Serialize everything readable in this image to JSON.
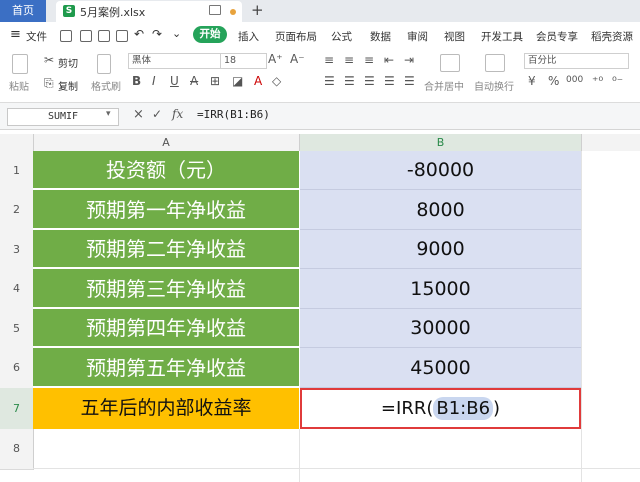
{
  "tabs": {
    "home": "首页",
    "file_name": "5月案例.xlsx",
    "file_badge": "S",
    "new_tab": "+"
  },
  "menu": {
    "hamburger": "≡",
    "file": "文件",
    "start": "开始",
    "items": [
      "插入",
      "页面布局",
      "公式",
      "数据",
      "审阅",
      "视图",
      "开发工具",
      "会员专享",
      "稻壳资源"
    ]
  },
  "ribbon": {
    "paste": "粘贴",
    "cut": "剪切",
    "copy": "复制",
    "format_painter": "格式刷",
    "font_name": "黑体",
    "font_size": "18",
    "merge_center": "合并居中",
    "wrap_text": "自动换行",
    "number_format": "百分比",
    "currency": "¥",
    "percent": "%",
    "thousands": "000"
  },
  "formula_bar": {
    "name_box": "SUMIF",
    "cancel": "×",
    "confirm": "✓",
    "fx": "fx",
    "formula": "=IRR(B1:B6)"
  },
  "columns": [
    "A",
    "B"
  ],
  "rows": [
    {
      "num": "1",
      "label": "投资额（元）",
      "value": "-80000"
    },
    {
      "num": "2",
      "label": "预期第一年净收益",
      "value": "8000"
    },
    {
      "num": "3",
      "label": "预期第二年净收益",
      "value": "9000"
    },
    {
      "num": "4",
      "label": "预期第三年净收益",
      "value": "15000"
    },
    {
      "num": "5",
      "label": "预期第四年净收益",
      "value": "30000"
    },
    {
      "num": "6",
      "label": "预期第五年净收益",
      "value": "45000"
    }
  ],
  "row7": {
    "num": "7",
    "label": "五年后的内部收益率",
    "formula_prefix": "=IRR(",
    "formula_ref": "B1:B6",
    "formula_suffix": ")"
  },
  "row8": {
    "num": "8"
  },
  "colors": {
    "green": "#70ad47",
    "blue_fill": "#dae0f2",
    "orange": "#ffc000",
    "selection": "#e03b3b",
    "accent": "#3b6fc4"
  }
}
